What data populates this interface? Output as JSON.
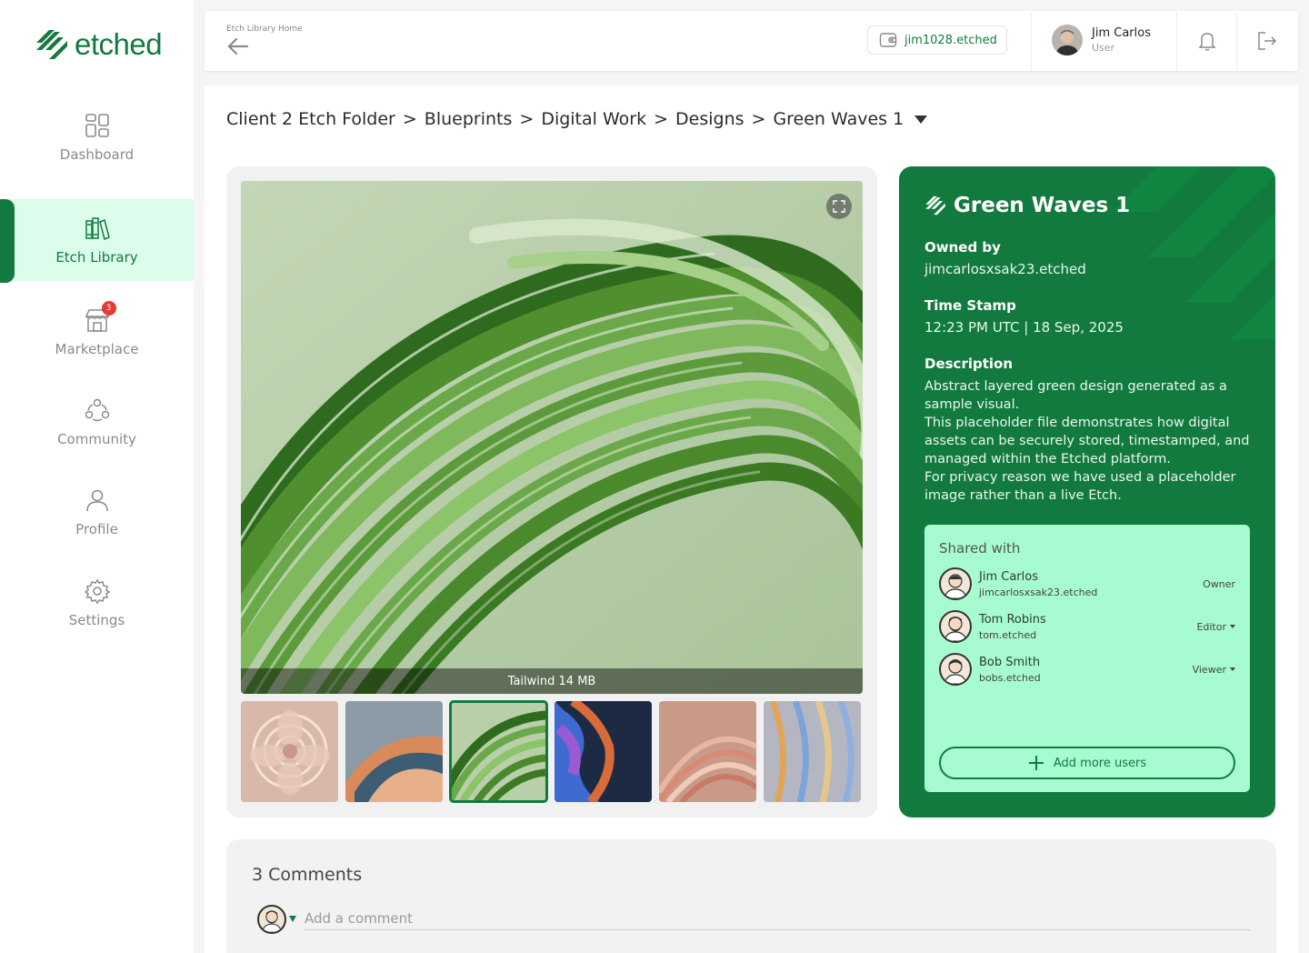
{
  "brand": {
    "name": "etched",
    "color": "#137a3f",
    "light": "#dcfdec",
    "mint": "#a6fbd0"
  },
  "sidebar": {
    "items": [
      {
        "label": "Dashboard",
        "icon": "dashboard-icon"
      },
      {
        "label": "Etch Library",
        "icon": "library-books-icon",
        "active": true
      },
      {
        "label": "Marketplace",
        "icon": "store-icon",
        "badge": "3"
      },
      {
        "label": "Community",
        "icon": "community-icon"
      },
      {
        "label": "Profile",
        "icon": "profile-icon"
      },
      {
        "label": "Settings",
        "icon": "gear-icon"
      }
    ]
  },
  "topbar": {
    "back_label": "Etch Library Home",
    "wallet": "jim1028.etched",
    "user": {
      "name": "Jim Carlos",
      "role": "User"
    }
  },
  "breadcrumb": [
    "Client 2 Etch Folder",
    "Blueprints",
    "Digital Work",
    "Designs",
    "Green Waves 1"
  ],
  "breadcrumb_sep": ">",
  "viewer": {
    "caption": "Tailwind 14 MB",
    "selected_thumb": 2
  },
  "info": {
    "title": "Green Waves 1",
    "owned_label": "Owned by",
    "owned_value": "jimcarlosxsak23.etched",
    "timestamp_label": "Time Stamp",
    "timestamp_value": "12:23 PM UTC | 18 Sep, 2025",
    "description_label": "Description",
    "description": "Abstract layered green design generated as a sample visual.\nThis placeholder file demonstrates how digital assets can be securely stored, timestamped, and managed within the Etched platform.\nFor privacy reason we have used a placeholder image rather than a live Etch.",
    "shared_title": "Shared with",
    "shared": [
      {
        "name": "Jim Carlos",
        "handle": "jimcarlosxsak23.etched",
        "role": "Owner",
        "dropdown": false
      },
      {
        "name": "Tom Robins",
        "handle": "tom.etched",
        "role": "Editor",
        "dropdown": true
      },
      {
        "name": "Bob Smith",
        "handle": "bobs.etched",
        "role": "Viewer",
        "dropdown": true
      }
    ],
    "add_users": "Add more users"
  },
  "comments": {
    "title": "3 Comments",
    "placeholder": "Add a comment"
  }
}
